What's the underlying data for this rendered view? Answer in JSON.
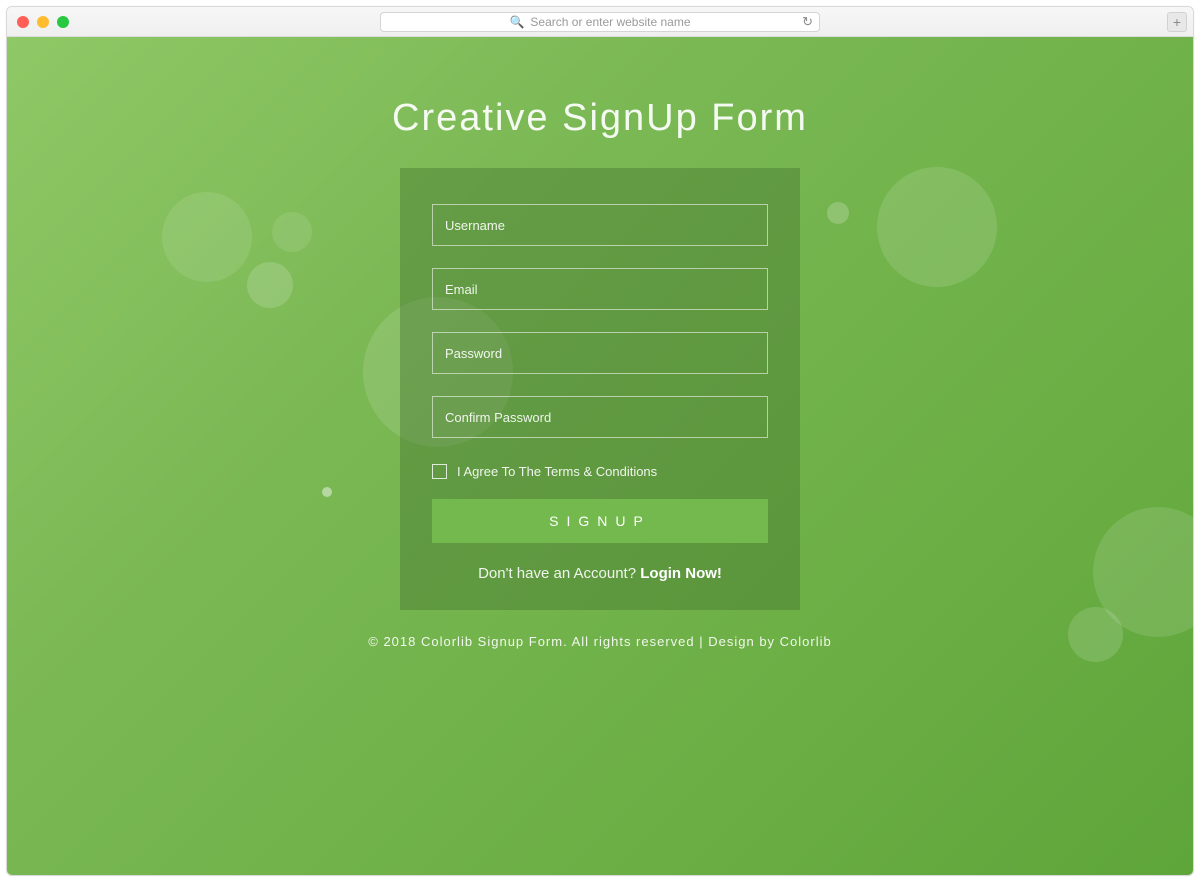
{
  "browser": {
    "address_placeholder": "Search or enter website name"
  },
  "page": {
    "title": "Creative SignUp Form"
  },
  "form": {
    "username_placeholder": "Username",
    "email_placeholder": "Email",
    "password_placeholder": "Password",
    "confirm_placeholder": "Confirm Password",
    "terms_label": "I Agree To The Terms & Conditions",
    "signup_button": "SIGNUP",
    "login_prompt": "Don't have an Account? ",
    "login_link": "Login Now!"
  },
  "footer": {
    "text": "© 2018 Colorlib Signup Form. All rights reserved | Design by Colorlib"
  }
}
